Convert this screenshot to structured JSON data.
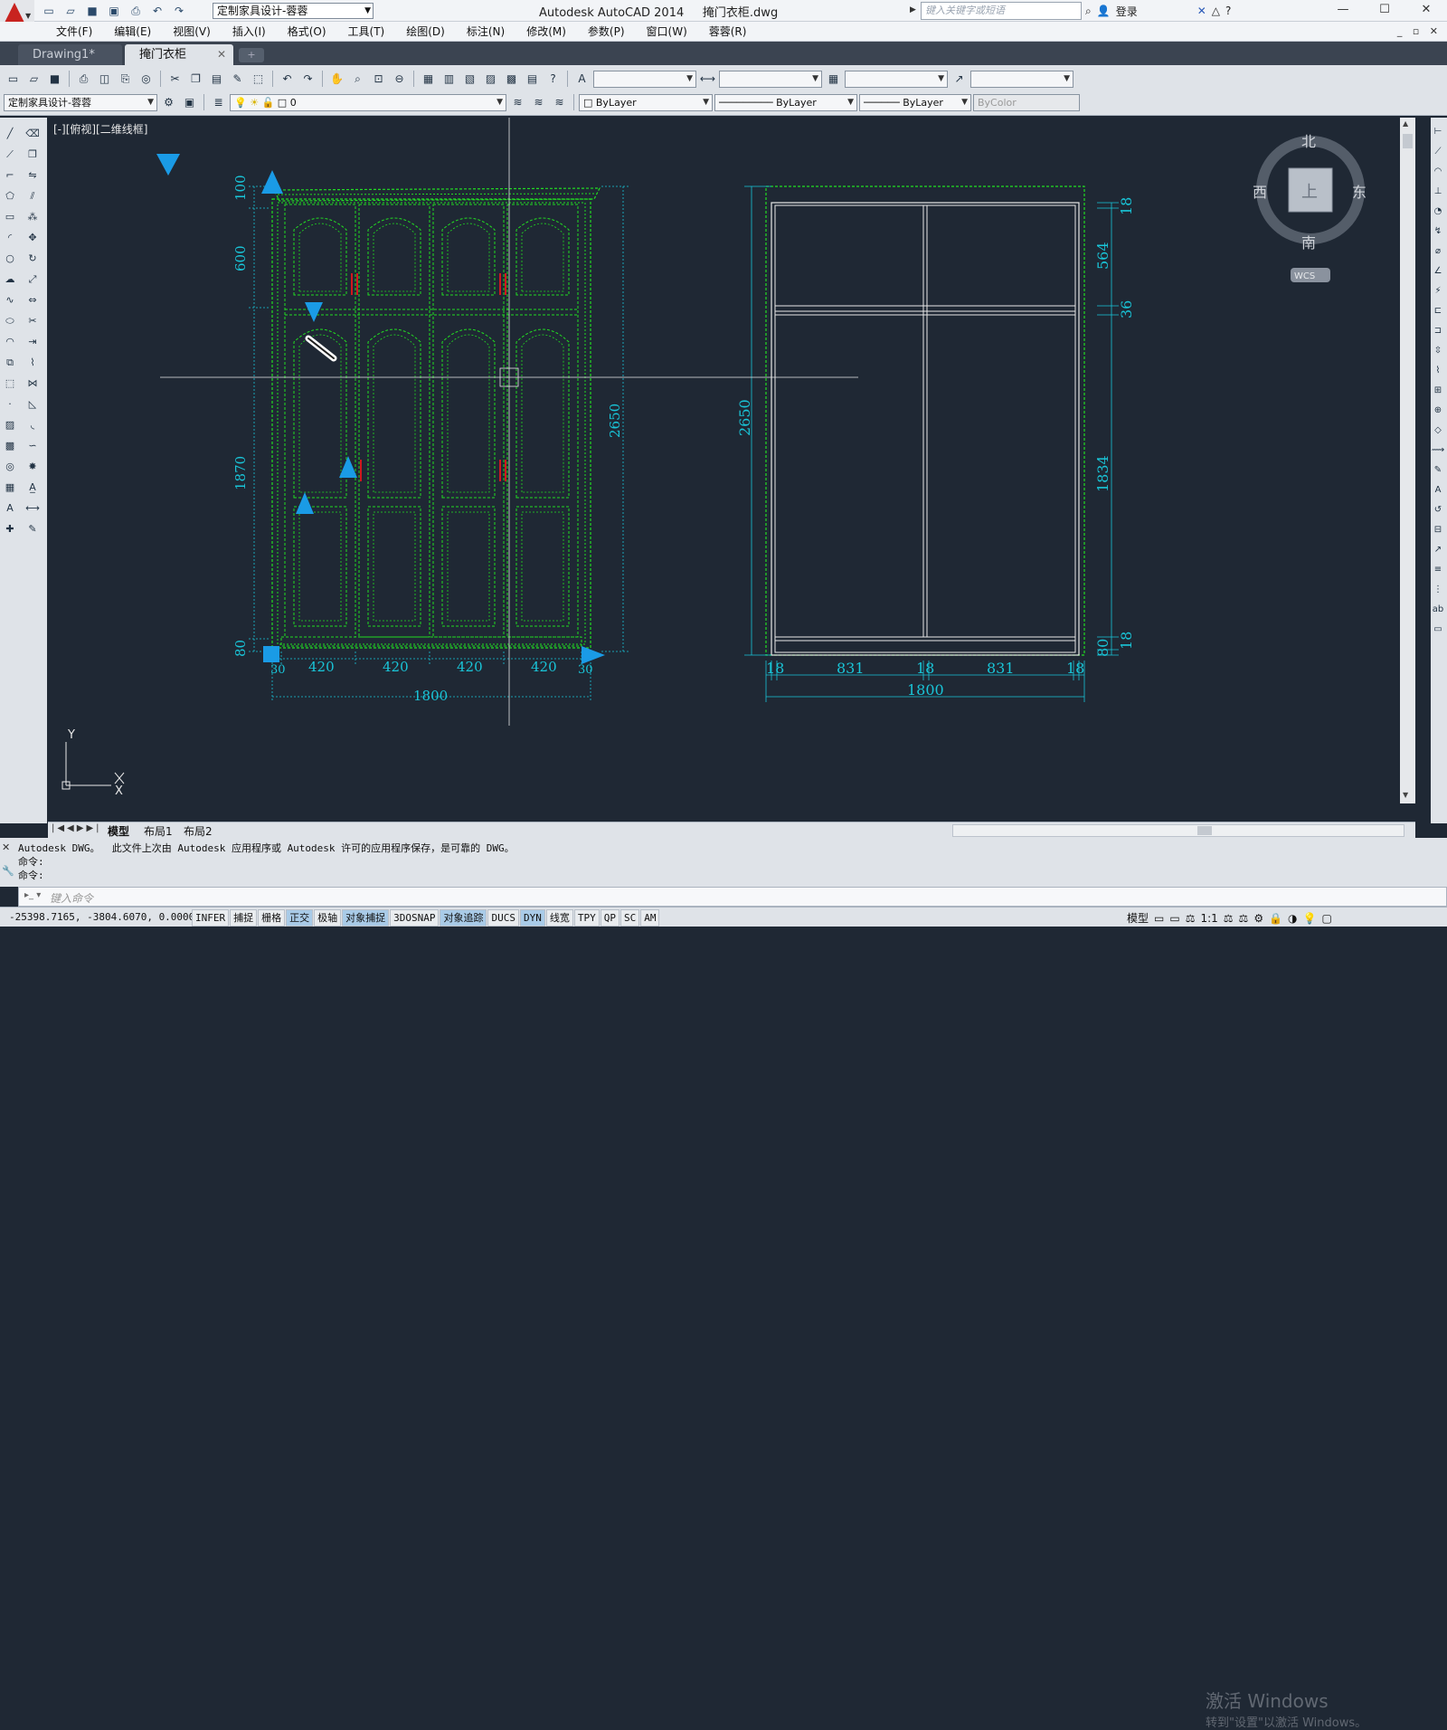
{
  "titlebar": {
    "workspace": "定制家具设计-蓉蓉",
    "app_title": "Autodesk AutoCAD 2014",
    "file_title": "掩门衣柜.dwg",
    "search_placeholder": "键入关键字或短语",
    "login": "登录"
  },
  "menu": [
    "文件(F)",
    "编辑(E)",
    "视图(V)",
    "插入(I)",
    "格式(O)",
    "工具(T)",
    "绘图(D)",
    "标注(N)",
    "修改(M)",
    "参数(P)",
    "窗口(W)",
    "蓉蓉(R)"
  ],
  "tabs": {
    "inactive": "Drawing1*",
    "active": "掩门衣柜"
  },
  "toolbar": {
    "workspace_combo": "定制家具设计-蓉蓉",
    "layer_combo": "0",
    "color_combo": "ByLayer",
    "linetype_combo": "ByLayer",
    "lineweight_combo": "ByLayer",
    "plotstyle_combo": "ByColor"
  },
  "viewport": {
    "label": "[-][俯视][二维线框]",
    "ucs_x": "X",
    "ucs_y": "Y",
    "viewcube": {
      "top": "上",
      "north": "北",
      "south": "南",
      "east": "东",
      "west": "西",
      "wcs": "WCS"
    }
  },
  "drawing": {
    "left_dims_vertical": [
      "100",
      "600",
      "1870",
      "80"
    ],
    "left_dims_horizontal": [
      "30",
      "420",
      "420",
      "420",
      "420",
      "30"
    ],
    "left_total_width": "1800",
    "left_total_height": "2650",
    "right_dims_vertical": [
      "18",
      "564",
      "36",
      "1834",
      "80",
      "18"
    ],
    "right_dims_horizontal": [
      "18",
      "831",
      "18",
      "831",
      "18"
    ],
    "right_total_width": "1800",
    "right_total_height": "2650",
    "colors": {
      "dim": "#19c5d8",
      "grip": "#1a9be6",
      "door_green": "#22dd22",
      "frame_white": "#e8e8e8",
      "handle_red": "#d0181d"
    }
  },
  "layout_tabs": [
    "模型",
    "布局1",
    "布局2"
  ],
  "command": {
    "line1": "Autodesk DWG。  此文件上次由 Autodesk 应用程序或 Autodesk 许可的应用程序保存，是可靠的 DWG。",
    "line2": "命令:",
    "line3": "命令:",
    "placeholder": "键入命令"
  },
  "watermark": {
    "line1": "激活 Windows",
    "line2": "转到\"设置\"以激活 Windows。"
  },
  "status": {
    "coords": "-25398.7165, -3804.6070, 0.0000",
    "buttons": [
      {
        "label": "INFER",
        "on": false
      },
      {
        "label": "捕捉",
        "on": false
      },
      {
        "label": "栅格",
        "on": false
      },
      {
        "label": "正交",
        "on": true
      },
      {
        "label": "极轴",
        "on": false
      },
      {
        "label": "对象捕捉",
        "on": true
      },
      {
        "label": "3DOSNAP",
        "on": false
      },
      {
        "label": "对象追踪",
        "on": true
      },
      {
        "label": "DUCS",
        "on": false
      },
      {
        "label": "DYN",
        "on": true
      },
      {
        "label": "线宽",
        "on": false
      },
      {
        "label": "TPY",
        "on": false
      },
      {
        "label": "QP",
        "on": false
      },
      {
        "label": "SC",
        "on": false
      },
      {
        "label": "AM",
        "on": false
      }
    ],
    "model": "模型",
    "scale": "1:1"
  }
}
